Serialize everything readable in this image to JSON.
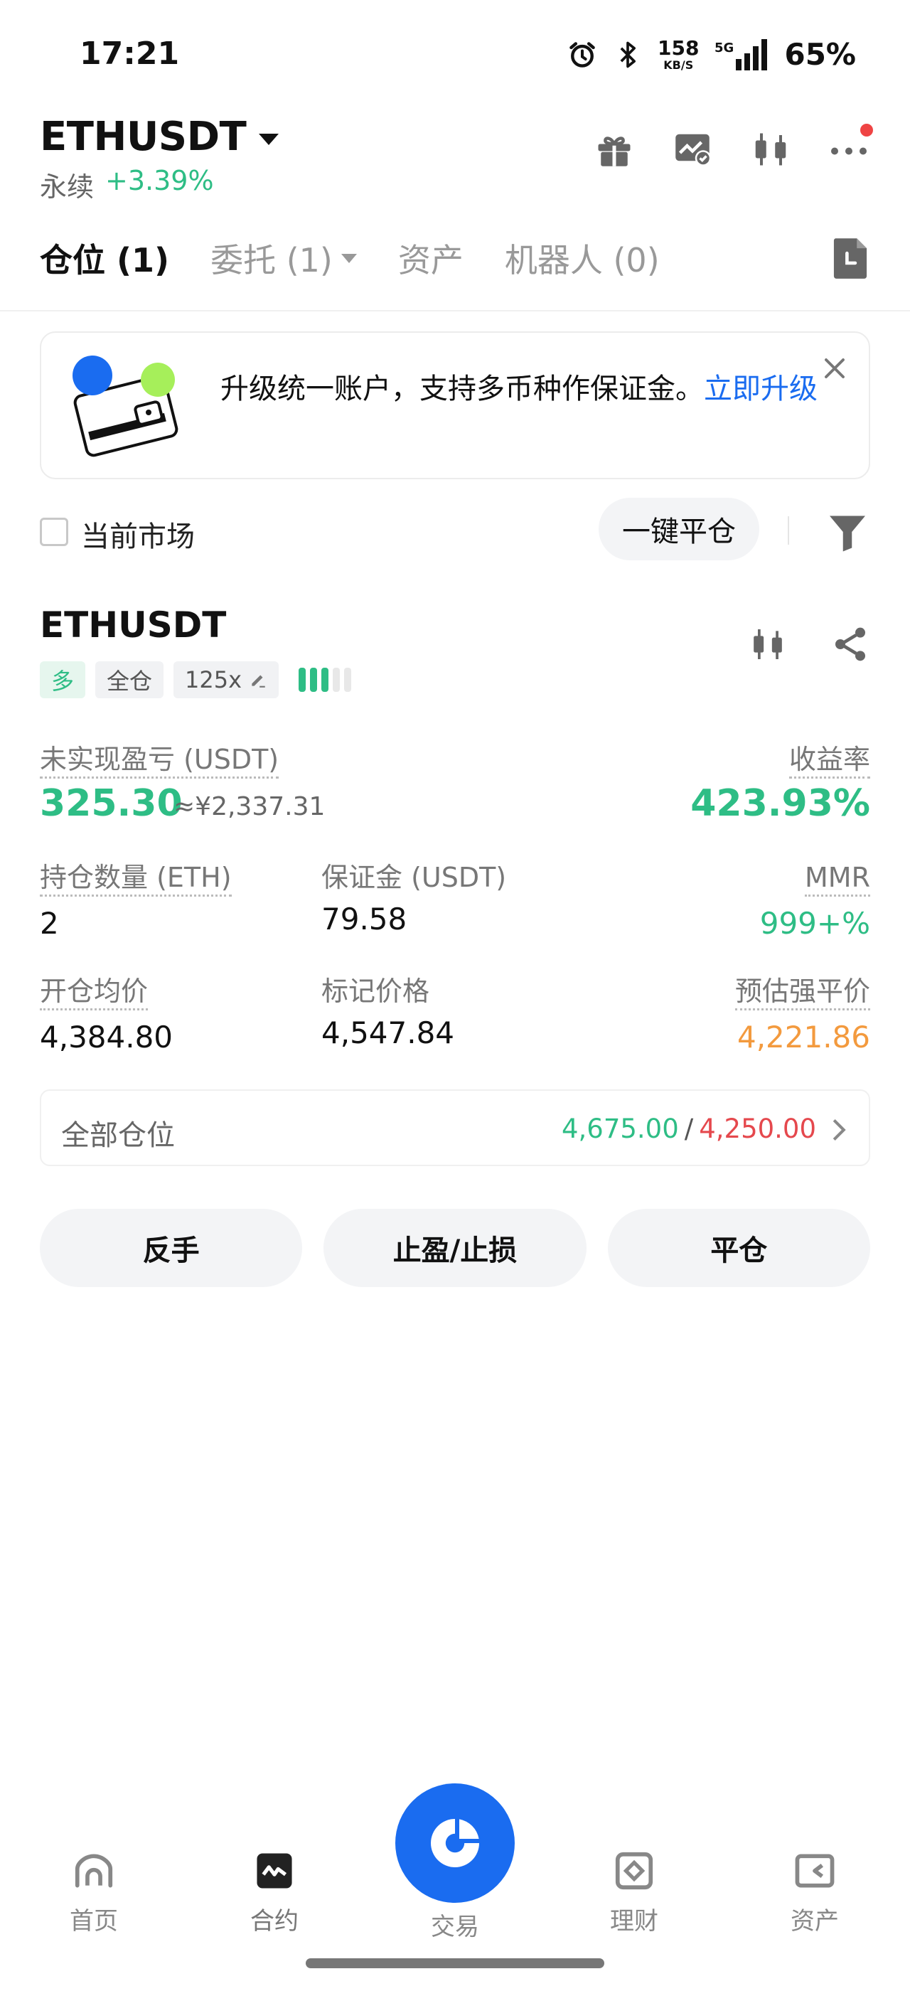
{
  "status_bar": {
    "time": "17:21",
    "net_speed": "158",
    "net_unit": "KB/S",
    "network": "5G",
    "battery": "65%"
  },
  "header": {
    "pair": "ETHUSDT",
    "perpetual": "永续",
    "change": "+3.39%",
    "icons": [
      "gift-icon",
      "chart-image-icon",
      "candlestick-icon",
      "more-icon"
    ]
  },
  "tabs": [
    {
      "label": "仓位 (1)",
      "active": true
    },
    {
      "label": "委托 (1)"
    },
    {
      "label": "资产"
    },
    {
      "label": "机器人 (0)"
    }
  ],
  "banner": {
    "text": "升级统一账户，支持多币种作保证金。",
    "link": "立即升级"
  },
  "filter": {
    "current_market": "当前市场",
    "close_all": "一键平仓"
  },
  "position": {
    "symbol": "ETHUSDT",
    "side": "多",
    "margin_mode": "全仓",
    "leverage": "125x",
    "unrealized_pnl_label": "未实现盈亏 (USDT)",
    "unrealized_pnl": "325.30",
    "unrealized_pnl_cny": "≈¥2,337.31",
    "roe_label": "收益率",
    "roe": "423.93%",
    "size_label": "持仓数量 (ETH)",
    "size": "2",
    "margin_label": "保证金 (USDT)",
    "margin": "79.58",
    "mmr_label": "MMR",
    "mmr": "999+%",
    "entry_label": "开仓均价",
    "entry": "4,384.80",
    "mark_label": "标记价格",
    "mark": "4,547.84",
    "liq_label": "预估强平价",
    "liq": "4,221.86",
    "all_positions_label": "全部仓位",
    "take_profit": "4,675.00",
    "separator": "/",
    "stop_loss": "4,250.00"
  },
  "actions": {
    "reverse": "反手",
    "tpsl": "止盈/止损",
    "close": "平仓"
  },
  "bottom_nav": {
    "home": "首页",
    "contract": "合约",
    "trade": "交易",
    "finance": "理财",
    "assets": "资产"
  },
  "colors": {
    "green": "#2ebd85",
    "red": "#e5484d",
    "orange": "#f39a3e",
    "brand_blue": "#1a6cf0"
  }
}
